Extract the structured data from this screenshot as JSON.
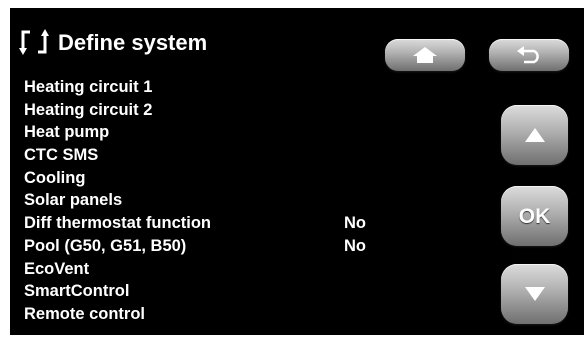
{
  "header": {
    "title": "Define system",
    "icon": "define-system-icon"
  },
  "menu": {
    "items": [
      {
        "label": "Heating circuit 1",
        "value": ""
      },
      {
        "label": "Heating circuit 2",
        "value": ""
      },
      {
        "label": "Heat pump",
        "value": ""
      },
      {
        "label": "CTC SMS",
        "value": ""
      },
      {
        "label": "Cooling",
        "value": ""
      },
      {
        "label": "Solar panels",
        "value": ""
      },
      {
        "label": "Diff thermostat function",
        "value": "No"
      },
      {
        "label": "Pool (G50, G51, B50)",
        "value": "No"
      },
      {
        "label": "EcoVent",
        "value": ""
      },
      {
        "label": "SmartControl",
        "value": ""
      },
      {
        "label": "Remote control",
        "value": ""
      }
    ]
  },
  "buttons": {
    "home_icon": "home-icon",
    "back_icon": "back-arrow-icon",
    "up_icon": "up-arrow-icon",
    "ok_label": "OK",
    "down_icon": "down-arrow-icon"
  },
  "colors": {
    "background": "#000000",
    "text": "#ffffff",
    "button": "#b4b4b4"
  }
}
